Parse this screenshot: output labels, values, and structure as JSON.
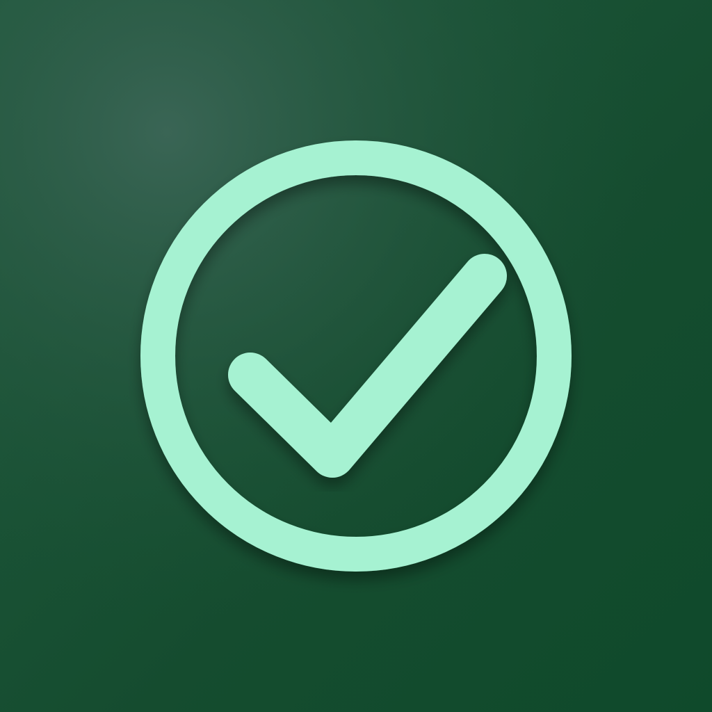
{
  "icon": {
    "name": "check-circle-icon",
    "colors": {
      "background_dark": "#0f4a2b",
      "background_mid": "#1b5236",
      "background_highlight": "#3a6555",
      "accent": "#a6f2d2"
    }
  }
}
